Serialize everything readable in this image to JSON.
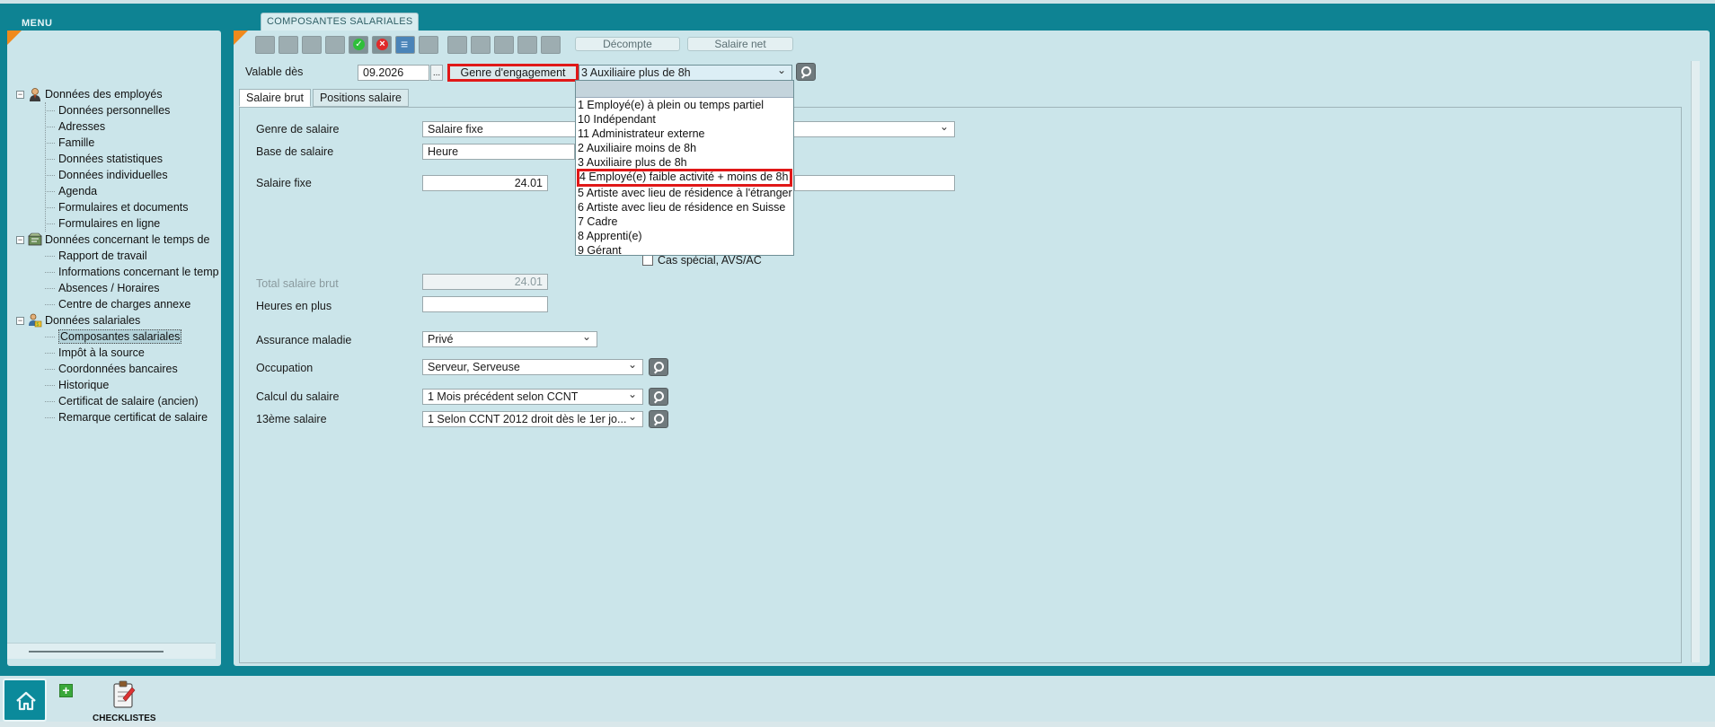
{
  "menu": {
    "title": "MENU",
    "groups": [
      {
        "label": "Données des employés",
        "icon": "employee-icon",
        "items": [
          "Données personnelles",
          "Adresses",
          "Famille",
          "Données statistiques",
          "Données individuelles",
          "Agenda",
          "Formulaires et documents",
          "Formulaires en ligne"
        ]
      },
      {
        "label": "Données concernant le temps de",
        "icon": "time-data-icon",
        "items": [
          "Rapport de travail",
          "Informations concernant le temps",
          "Absences / Horaires",
          "Centre de charges annexe"
        ]
      },
      {
        "label": "Données salariales",
        "icon": "salary-data-icon",
        "items": [
          "Composantes salariales",
          "Impôt à la source",
          "Coordonnées bancaires",
          "Historique",
          "Certificat de salaire (ancien)",
          "Remarque certificat de salaire"
        ]
      }
    ],
    "selected": "Composantes salariales"
  },
  "main": {
    "tab_title": "COMPOSANTES SALARIALES",
    "decompte_label": "Décompte",
    "salaire_net_label": "Salaire net",
    "valable_label": "Valable dès",
    "valable_value": "09.2026",
    "dots_label": "...",
    "genre_label": "Genre d'engagement",
    "genre_value": "3 Auxiliaire plus de 8h",
    "subtabs": [
      "Salaire brut",
      "Positions salaire"
    ],
    "fields": {
      "genre_salaire_label": "Genre de salaire",
      "genre_salaire_value": "Salaire fixe",
      "base_salaire_label": "Base de salaire",
      "base_salaire_value": "Heure",
      "salaire_fixe_label": "Salaire fixe",
      "salaire_fixe_value": "24.01",
      "cas_special_label": "Cas spécial, AVS/AC",
      "total_brut_label": "Total salaire brut",
      "total_brut_value": "24.01",
      "heures_plus_label": "Heures en plus",
      "heures_plus_value": "",
      "assurance_label": "Assurance maladie",
      "assurance_value": "Privé",
      "occupation_label": "Occupation",
      "occupation_value": "Serveur, Serveuse",
      "calcul_label": "Calcul du salaire",
      "calcul_value": "1 Mois précédent selon CCNT",
      "treizieme_label": "13ème salaire",
      "treizieme_value": "1 Selon CCNT 2012 droit dès le 1er jo..."
    },
    "dropdown": {
      "options": [
        "1 Employé(e) à plein ou temps partiel",
        "10 Indépendant",
        "11 Administrateur externe",
        "2 Auxiliaire moins de 8h",
        "3 Auxiliaire plus de 8h",
        "4 Employé(e) faible activité + moins de 8h",
        "5 Artiste avec lieu de résidence à l'étranger",
        "6 Artiste avec lieu de résidence en Suisse",
        "7 Cadre",
        "8 Apprenti(e)",
        "9 Gérant"
      ],
      "highlighted_index": 5
    }
  },
  "bottom": {
    "checklist_label": "CHECKLISTES"
  },
  "colors": {
    "background": "#0e8393",
    "panel": "#cbe5ea",
    "highlight": "#e01818"
  }
}
